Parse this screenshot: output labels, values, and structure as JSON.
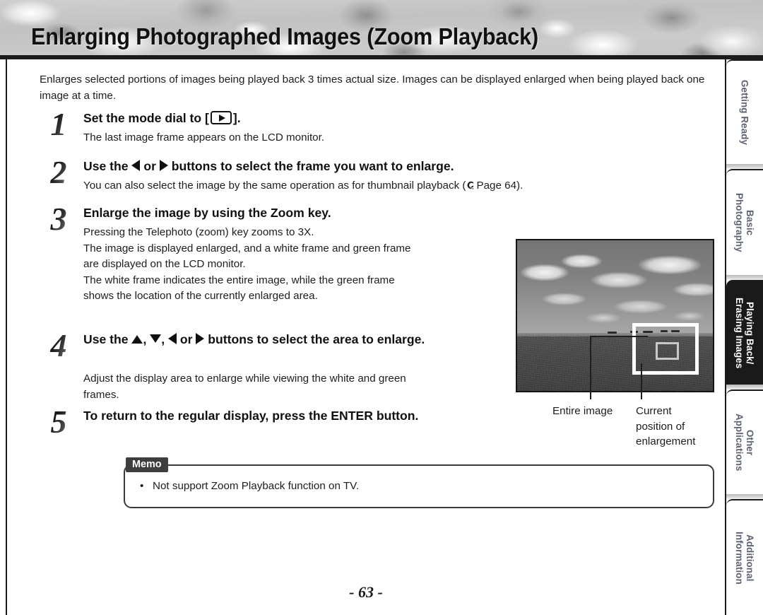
{
  "header": {
    "title": "Enlarging Photographed Images (Zoom Playback)"
  },
  "intro": "Enlarges selected portions of images being played back 3 times actual size. Images can be displayed enlarged when being played back one image at a time.",
  "steps": [
    {
      "number": "1",
      "heading_pre": "Set the mode dial to [",
      "heading_post": "].",
      "icon": "playback-mode-dial-icon",
      "body": "The last image frame appears on the LCD monitor."
    },
    {
      "number": "2",
      "heading_pre": "Use the",
      "heading_mid": "or",
      "heading_post": "buttons to select the frame you want to enlarge.",
      "body_pre": "You can also select the image by the same operation as for thumbnail playback (",
      "body_post": "Page 64)."
    },
    {
      "number": "3",
      "heading": "Enlarge the image by using the Zoom key.",
      "body_lines": [
        "Pressing the Telephoto (zoom) key zooms to 3X.",
        "The image is displayed enlarged, and a white frame and green frame",
        "are displayed on the LCD monitor.",
        "The white frame indicates the entire image, while the green frame",
        "shows the location of the currently enlarged area."
      ]
    },
    {
      "number": "4",
      "heading_pre": "Use the",
      "heading_comma1": ",",
      "heading_comma2": ",",
      "heading_mid": "or",
      "heading_post": "buttons to select the area to enlarge.",
      "body_lines": [
        "Adjust the display area to enlarge while viewing the white and green",
        "frames."
      ]
    },
    {
      "number": "5",
      "heading": "To return to the regular display, press the ENTER button."
    }
  ],
  "photo": {
    "alt": "lcd-preview-landscape-photo",
    "captions": {
      "entire_image": "Entire image",
      "current_position": "Current\nposition of\nenlargement"
    }
  },
  "memo": {
    "label": "Memo",
    "bullet": "•",
    "items": [
      "Not support Zoom Playback function on TV."
    ]
  },
  "page_number": "- 63 -",
  "tabs": [
    {
      "label": "Getting Ready",
      "active": false
    },
    {
      "label": "Basic\nPhotography",
      "active": false
    },
    {
      "label": "Playing Back/\nErasing Images",
      "active": true
    },
    {
      "label": "Other\nApplications",
      "active": false
    },
    {
      "label": "Additional\nInformation",
      "active": false
    }
  ],
  "colors": {
    "ink": "#1d1d1d",
    "rule": "#1c1c1c",
    "active_tab_bg": "#1a1a1a",
    "tab_text": "#5c6270",
    "memo_label_bg": "#3e3e3e"
  }
}
